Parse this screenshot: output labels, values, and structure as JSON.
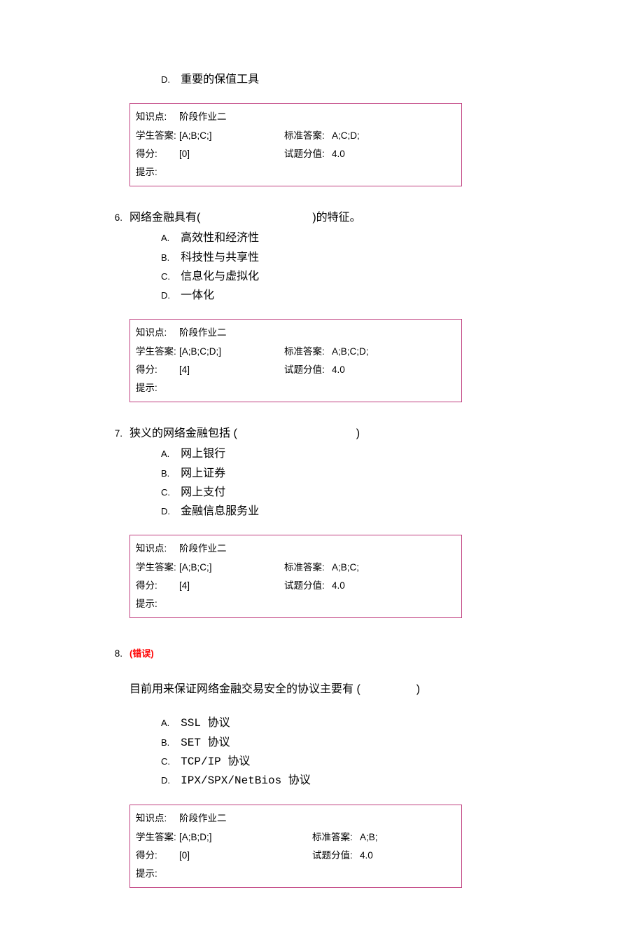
{
  "q5": {
    "optionD": {
      "letter": "D.",
      "text": "重要的保值工具"
    },
    "info": {
      "kp_label": "知识点:",
      "kp": "阶段作业二",
      "sa_label": "学生答案:",
      "sa": "[A;B;C;]",
      "ca_label": "标准答案:",
      "ca": "A;C;D;",
      "score_label": "得分:",
      "score": "[0]",
      "pv_label": "试题分值:",
      "pv": "4.0",
      "hint_label": "提示:"
    }
  },
  "q6": {
    "num": "6.",
    "text_pre": "网络金融具有(",
    "text_post": ")的特征。",
    "options": [
      {
        "letter": "A.",
        "text": "高效性和经济性"
      },
      {
        "letter": "B.",
        "text": "科技性与共享性"
      },
      {
        "letter": "C.",
        "text": "信息化与虚拟化"
      },
      {
        "letter": "D.",
        "text": "一体化"
      }
    ],
    "info": {
      "kp_label": "知识点:",
      "kp": "阶段作业二",
      "sa_label": "学生答案:",
      "sa": "[A;B;C;D;]",
      "ca_label": "标准答案:",
      "ca": "A;B;C;D;",
      "score_label": "得分:",
      "score": "[4]",
      "pv_label": "试题分值:",
      "pv": "4.0",
      "hint_label": "提示:"
    }
  },
  "q7": {
    "num": "7.",
    "text_pre": "狭义的网络金融包括   (",
    "text_post": ")",
    "options": [
      {
        "letter": "A.",
        "text": "网上银行"
      },
      {
        "letter": "B.",
        "text": "网上证券"
      },
      {
        "letter": "C.",
        "text": "网上支付"
      },
      {
        "letter": "D.",
        "text": "金融信息服务业"
      }
    ],
    "info": {
      "kp_label": "知识点:",
      "kp": "阶段作业二",
      "sa_label": "学生答案:",
      "sa": "[A;B;C;]",
      "ca_label": "标准答案:",
      "ca": "A;B;C;",
      "score_label": "得分:",
      "score": "[4]",
      "pv_label": "试题分值:",
      "pv": "4.0",
      "hint_label": "提示:"
    }
  },
  "q8": {
    "num": "8.",
    "error": "(错误)",
    "question_pre": "目前用来保证网络金融交易安全的协议主要有   (",
    "question_post": ")",
    "options": [
      {
        "letter": "A.",
        "text": "SSL 协议"
      },
      {
        "letter": "B.",
        "text": "SET 协议"
      },
      {
        "letter": "C.",
        "text": "TCP/IP 协议"
      },
      {
        "letter": "D.",
        "text": "IPX/SPX/NetBios 协议"
      }
    ],
    "info": {
      "kp_label": "知识点:",
      "kp": "阶段作业二",
      "sa_label": "学生答案:",
      "sa": "[A;B;D;]",
      "ca_label": "标准答案:",
      "ca": "A;B;",
      "score_label": "得分:",
      "score": "[0]",
      "pv_label": "试题分值:",
      "pv": "4.0",
      "hint_label": "提示:"
    }
  }
}
